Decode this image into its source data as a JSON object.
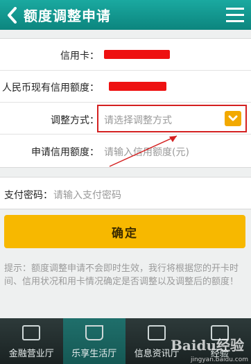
{
  "header": {
    "title": "额度调整申请",
    "back_icon": "chevron-left-icon",
    "menu_icon": "list-menu-icon"
  },
  "form": {
    "card_label": "信用卡：",
    "limit_label": "人民币现有信用额度：",
    "method_label": "调整方式：",
    "method_placeholder": "请选择调整方式",
    "amount_label": "申请信用额度：",
    "amount_placeholder": "请输入信用额度(元)"
  },
  "password": {
    "label": "支付密码：",
    "placeholder": "请输入支付密码"
  },
  "confirm_label": "确定",
  "tip": "提示：额度调整申请不会即时生效，我行将根据您的开卡时间、信用状况和用卡情况确定是否调整以及调整后的额度！",
  "tabs": [
    {
      "label": "金融营业厅",
      "icon": "briefcase-icon"
    },
    {
      "label": "乐享生活厅",
      "icon": "cup-icon"
    },
    {
      "label": "信息资讯厅",
      "icon": "newspaper-icon"
    },
    {
      "label": "经验",
      "icon": "grid-icon"
    }
  ],
  "watermark": {
    "logo": "Baidu经验",
    "url": "jingyan.baidu.com"
  },
  "colors": {
    "header": "#0c857e",
    "accent": "#f7b800",
    "redaction": "#ee1111",
    "annotation": "#d42020"
  }
}
